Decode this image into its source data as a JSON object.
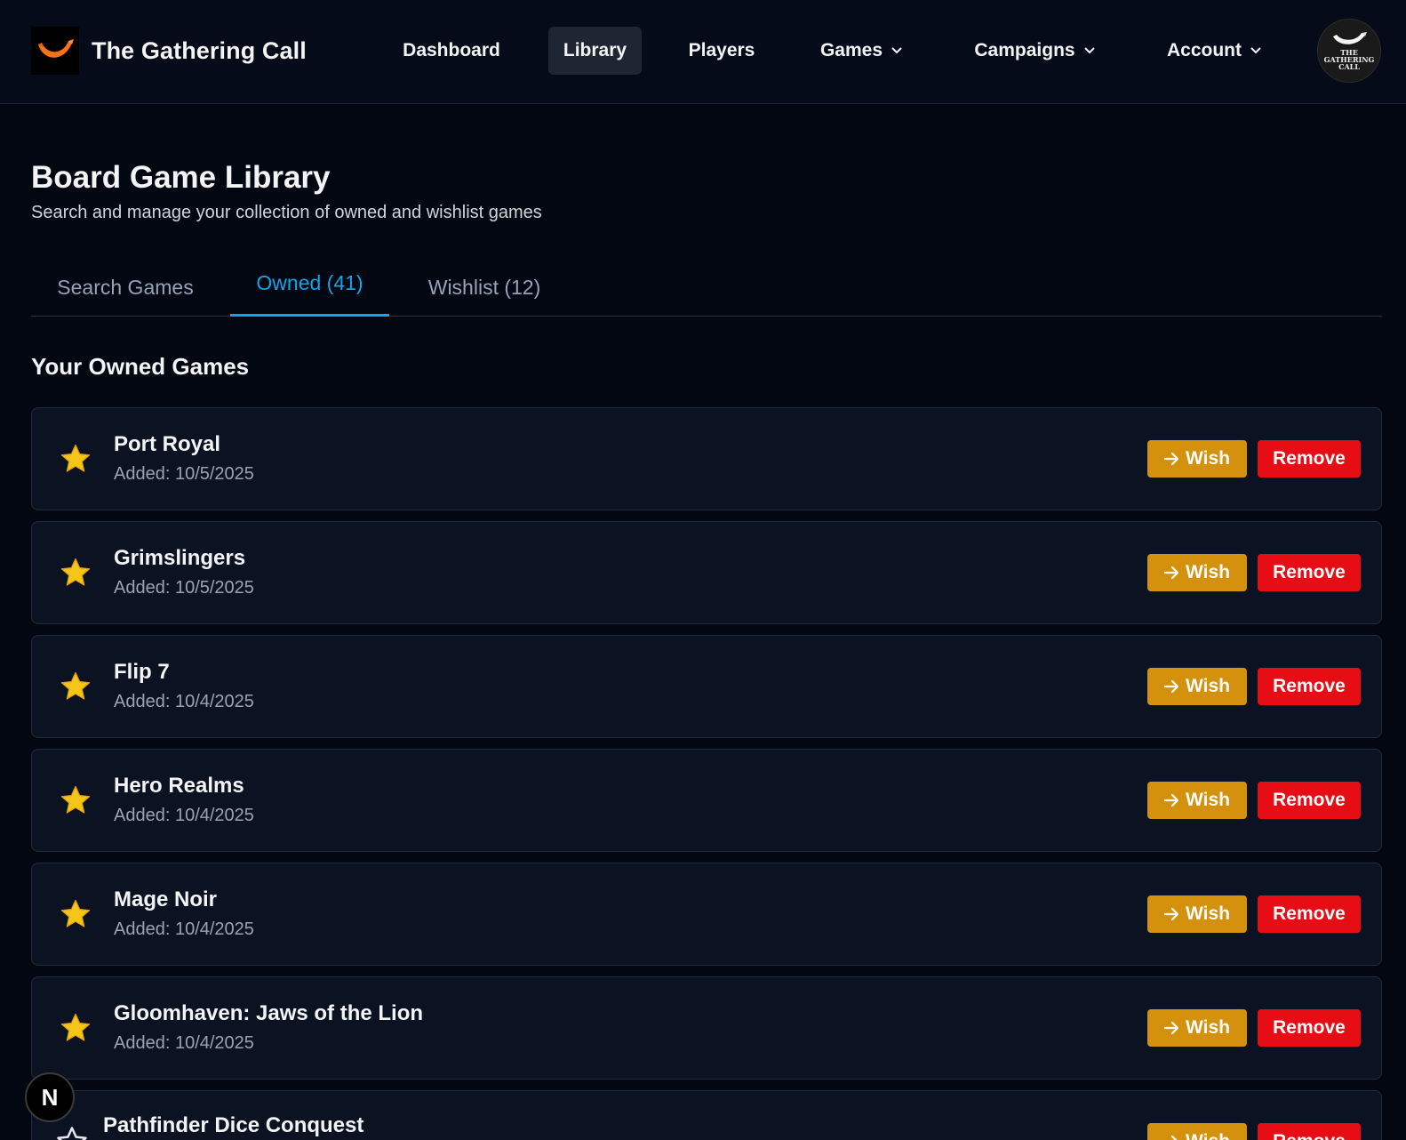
{
  "brand": {
    "name": "The Gathering Call"
  },
  "nav": {
    "items": [
      {
        "label": "Dashboard"
      },
      {
        "label": "Library"
      },
      {
        "label": "Players"
      },
      {
        "label": "Games"
      },
      {
        "label": "Campaigns"
      },
      {
        "label": "Account"
      }
    ],
    "active": "Library"
  },
  "avatar": {
    "line1": "THE",
    "line2": "GATHERING",
    "line3": "CALL"
  },
  "header": {
    "title": "Board Game Library",
    "subtitle": "Search and manage your collection of owned and wishlist games"
  },
  "tabs": [
    {
      "label": "Search Games"
    },
    {
      "label": "Owned (41)"
    },
    {
      "label": "Wishlist (12)"
    }
  ],
  "active_tab": "Owned (41)",
  "section": {
    "title": "Your Owned Games"
  },
  "games": [
    {
      "name": "Port Royal",
      "added": "Added: 10/5/2025",
      "favorite": true
    },
    {
      "name": "Grimslingers",
      "added": "Added: 10/5/2025",
      "favorite": true
    },
    {
      "name": "Flip 7",
      "added": "Added: 10/4/2025",
      "favorite": true
    },
    {
      "name": "Hero Realms",
      "added": "Added: 10/4/2025",
      "favorite": true
    },
    {
      "name": "Mage Noir",
      "added": "Added: 10/4/2025",
      "favorite": true
    },
    {
      "name": "Gloomhaven: Jaws of the Lion",
      "added": "Added: 10/4/2025",
      "favorite": true
    },
    {
      "name": "Pathfinder Dice Conquest",
      "favorite": false
    }
  ],
  "buttons": {
    "wish_label": "Wish",
    "remove_label": "Remove"
  },
  "badge": {
    "label": "N"
  },
  "colors": {
    "background": "#030712",
    "accent": "#0ea5e9",
    "wish": "#d4910b",
    "remove": "#e60d15",
    "star": "#f5c518"
  }
}
